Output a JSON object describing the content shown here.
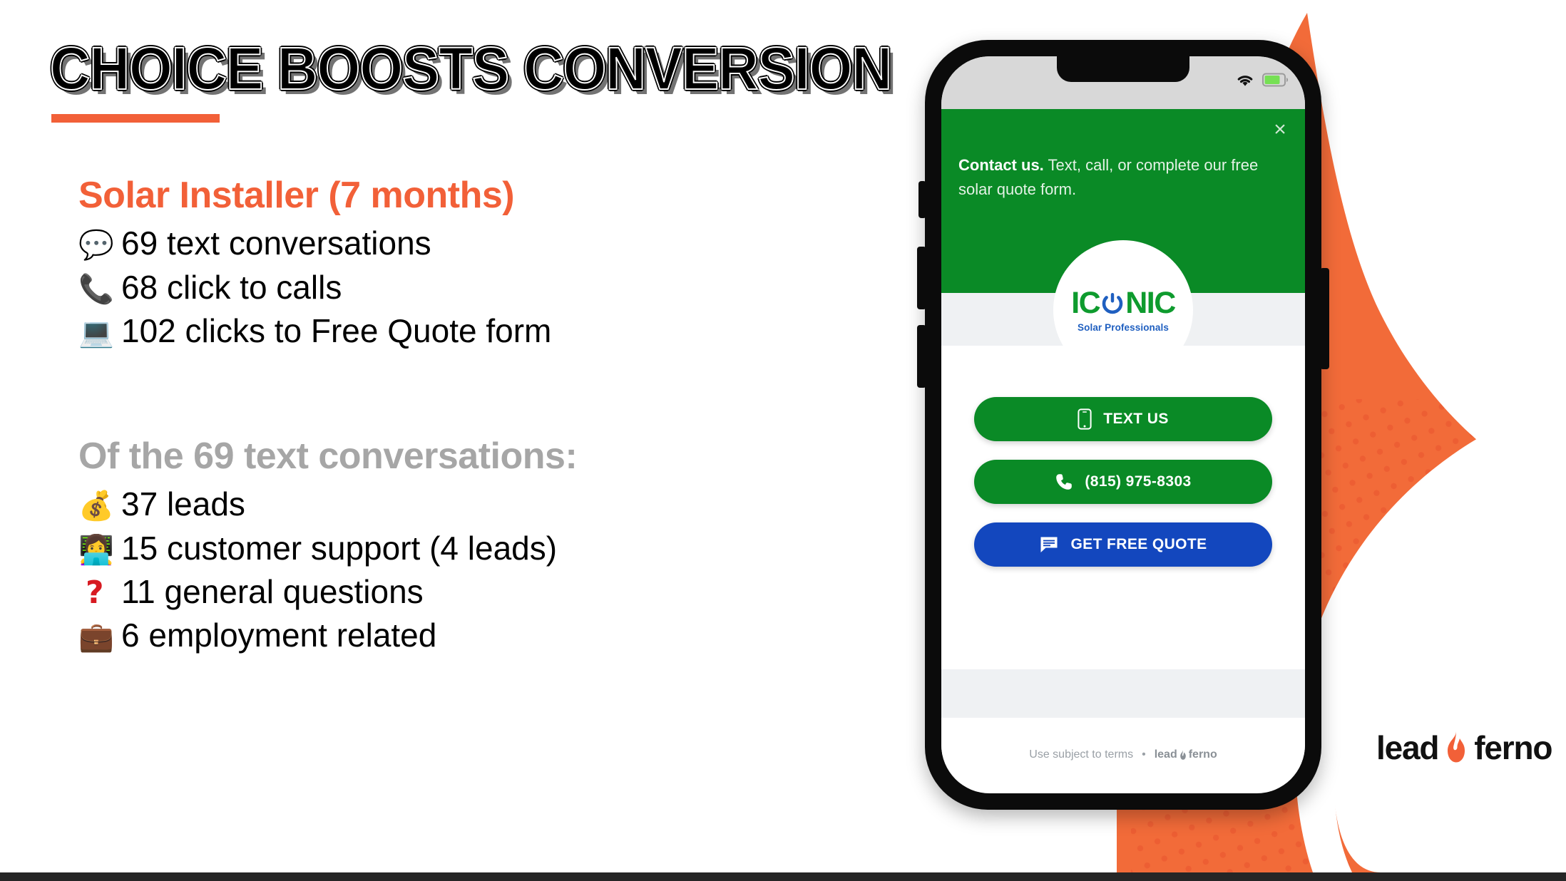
{
  "slide": {
    "title": "CHOICE BOOSTS CONVERSION",
    "accent_color": "#F26038",
    "gray_color": "#A6A6A6"
  },
  "sections": [
    {
      "heading": "Solar Installer (7 months)",
      "heading_style": "orange",
      "items": [
        {
          "emoji": "💬",
          "emoji_name": "speech-balloon-emoji",
          "text": "69 text conversations"
        },
        {
          "emoji": "📞",
          "emoji_name": "telephone-receiver-emoji",
          "text": "68 click to calls"
        },
        {
          "emoji": "💻",
          "emoji_name": "laptop-emoji",
          "text": "102 clicks to Free Quote form"
        }
      ]
    },
    {
      "heading": "Of the 69 text conversations:",
      "heading_style": "gray",
      "items": [
        {
          "emoji": "💰",
          "emoji_name": "money-bag-emoji",
          "text": "37 leads"
        },
        {
          "emoji": "👩‍💻",
          "emoji_name": "person-with-laptop-emoji",
          "text": "15 customer support (4 leads)"
        },
        {
          "emoji": "❓",
          "emoji_name": "question-mark-emoji",
          "text": "11 general questions"
        },
        {
          "emoji": "💼",
          "emoji_name": "briefcase-emoji",
          "text": "6 employment related"
        }
      ]
    }
  ],
  "phone": {
    "status_bar": {
      "wifi_icon": "wifi-icon",
      "battery_icon": "battery-icon",
      "battery_color": "#76E054"
    },
    "widget": {
      "close_label": "×",
      "headline_bold": "Contact us.",
      "headline_rest": " Text, call, or complete our free solar quote form.",
      "brand": {
        "word_one": "IC",
        "word_two": "NIC",
        "tagline": "Solar Professionals",
        "wordmark_color": "#0E9B2E",
        "tagline_color": "#1F5FC0"
      },
      "buttons": [
        {
          "label": "TEXT US",
          "icon": "mobile-phone-icon",
          "color": "#0A8A26"
        },
        {
          "label": "(815) 975-8303",
          "icon": "phone-handset-icon",
          "color": "#0A8A26"
        },
        {
          "label": "GET FREE QUOTE",
          "icon": "chat-message-icon",
          "color": "#1347BE"
        }
      ],
      "footer": {
        "terms": "Use subject to terms",
        "separator": "•",
        "brand_left": "lead",
        "brand_right": "ferno"
      }
    }
  },
  "branding": {
    "logo_left": "lead",
    "logo_right": "ferno",
    "flame_color": "#F26038",
    "flame_color_dark": "#EF5A2B"
  }
}
